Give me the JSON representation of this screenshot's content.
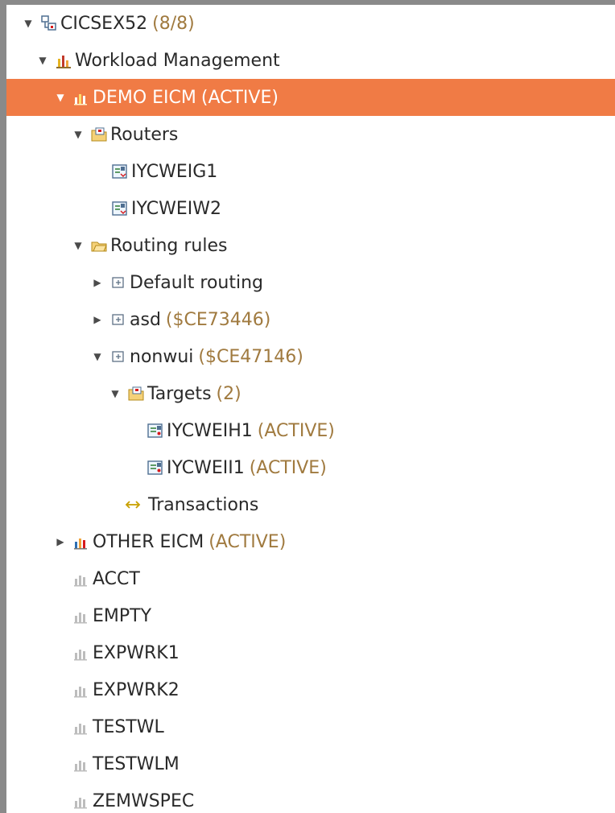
{
  "tree": {
    "root": {
      "label": "CICSEX52",
      "extra": "(8/8)",
      "icon": "server-icon"
    },
    "workload_management": {
      "label": "Workload Management",
      "icon": "workload-icon"
    },
    "demo_eicm": {
      "label": "DEMO EICM",
      "extra": "(ACTIVE)",
      "icon": "chart-active-icon",
      "selected": true
    },
    "routers": {
      "label": "Routers",
      "icon": "folder-icon"
    },
    "router_items": [
      {
        "label": "IYCWEIG1",
        "icon": "router-icon"
      },
      {
        "label": "IYCWEIW2",
        "icon": "router-icon"
      }
    ],
    "routing_rules": {
      "label": "Routing rules",
      "icon": "folder-open-icon"
    },
    "rules": [
      {
        "label": "Default routing",
        "extra": "",
        "icon": "rule-icon",
        "expanded": false
      },
      {
        "label": "asd",
        "extra": "($CE73446)",
        "icon": "rule-icon",
        "expanded": false
      },
      {
        "label": "nonwui",
        "extra": "($CE47146)",
        "icon": "rule-icon",
        "expanded": true
      }
    ],
    "targets": {
      "label": "Targets",
      "extra": "(2)",
      "icon": "folder-icon"
    },
    "target_items": [
      {
        "label": "IYCWEIH1",
        "extra": "(ACTIVE)",
        "icon": "target-icon"
      },
      {
        "label": "IYCWEII1",
        "extra": "(ACTIVE)",
        "icon": "target-icon"
      }
    ],
    "transactions": {
      "label": "Transactions",
      "icon": "transaction-icon"
    },
    "other_eicm": {
      "label": "OTHER EICM",
      "extra": "(ACTIVE)",
      "icon": "chart-active-icon"
    },
    "workloads": [
      {
        "label": "ACCT",
        "icon": "chart-icon"
      },
      {
        "label": "EMPTY",
        "icon": "chart-icon"
      },
      {
        "label": "EXPWRK1",
        "icon": "chart-icon"
      },
      {
        "label": "EXPWRK2",
        "icon": "chart-icon"
      },
      {
        "label": "TESTWL",
        "icon": "chart-icon"
      },
      {
        "label": "TESTWLM",
        "icon": "chart-icon"
      },
      {
        "label": "ZEMWSPEC",
        "icon": "chart-icon"
      }
    ]
  },
  "colors": {
    "selection": "#f07b45",
    "status_text": "#a07a3f",
    "frame": "#8a8a8a"
  },
  "twisty": {
    "expanded": "▼",
    "collapsed": "▶"
  }
}
